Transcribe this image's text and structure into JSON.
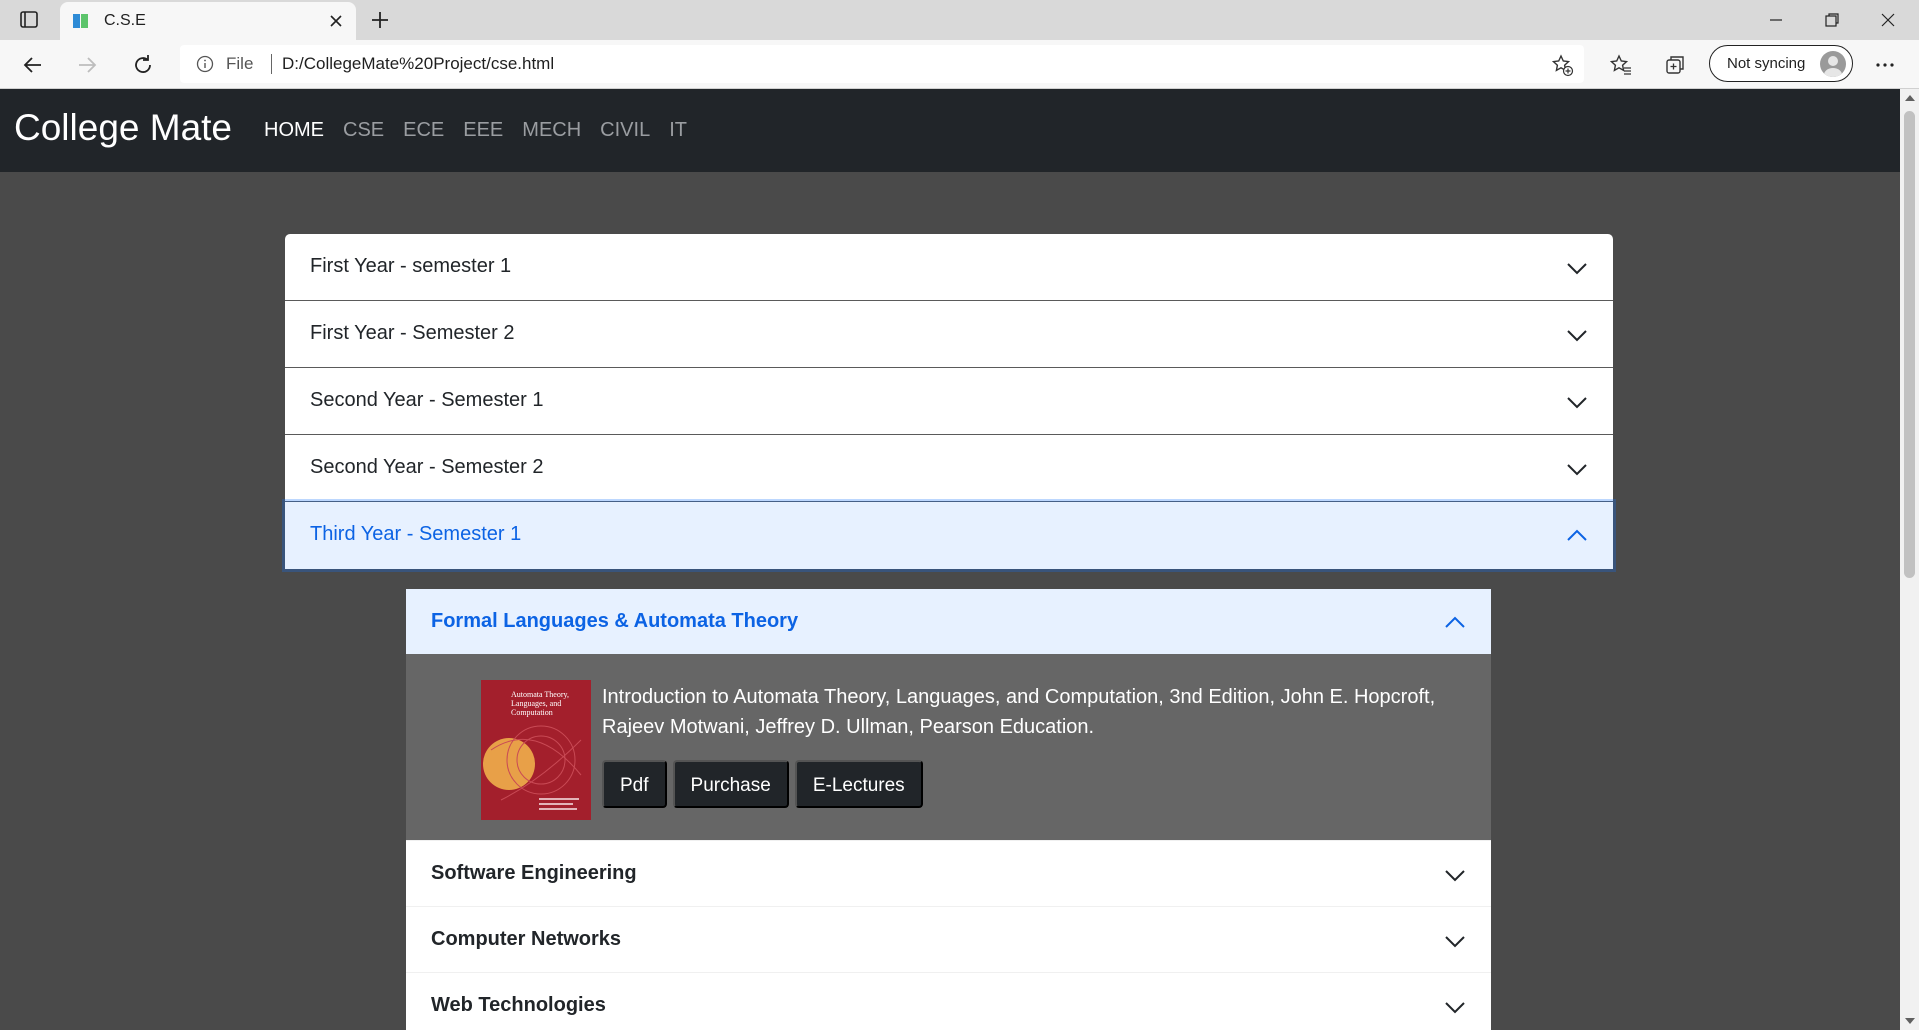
{
  "browser": {
    "tab_title": "C.S.E",
    "address_scheme": "File",
    "url": "D:/CollegeMate%20Project/cse.html",
    "sync_label": "Not syncing"
  },
  "navbar": {
    "brand": "College Mate",
    "links": [
      {
        "label": "HOME",
        "active": true
      },
      {
        "label": "CSE",
        "active": false
      },
      {
        "label": "ECE",
        "active": false
      },
      {
        "label": "EEE",
        "active": false
      },
      {
        "label": "MECH",
        "active": false
      },
      {
        "label": "CIVIL",
        "active": false
      },
      {
        "label": "IT",
        "active": false
      }
    ]
  },
  "semesters": [
    {
      "title": "First Year - semester 1",
      "expanded": false
    },
    {
      "title": "First Year - Semester 2",
      "expanded": false
    },
    {
      "title": "Second Year - Semester 1",
      "expanded": false
    },
    {
      "title": "Second Year - Semester 2",
      "expanded": false
    },
    {
      "title": "Third Year - Semester 1",
      "expanded": true
    }
  ],
  "subjects": [
    {
      "title": "Formal Languages & Automata Theory",
      "expanded": true,
      "book": {
        "cover_title": "Automata Theory, Languages, and Computation",
        "description": "Introduction to Automata Theory, Languages, and Computation, 3nd Edition, John E. Hopcroft, Rajeev Motwani, Jeffrey D. Ullman, Pearson Education.",
        "buttons": [
          "Pdf",
          "Purchase",
          "E-Lectures"
        ]
      }
    },
    {
      "title": "Software Engineering",
      "expanded": false
    },
    {
      "title": "Computer Networks",
      "expanded": false
    },
    {
      "title": "Web Technologies",
      "expanded": false
    }
  ],
  "colors": {
    "navbar_bg": "#212529",
    "page_bg": "#4a4a4a",
    "accent": "#0c63e4",
    "active_header_bg": "#e7f1ff",
    "book_cover": "#a31f2c"
  }
}
